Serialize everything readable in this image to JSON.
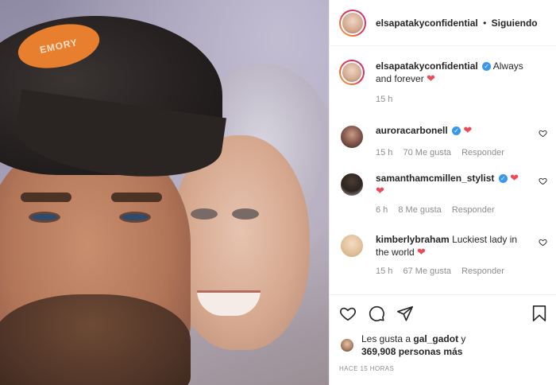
{
  "post": {
    "author": "elsapatakyconfidential",
    "separator": "•",
    "follow_state": "Siguiendo",
    "caption_text": "Always and forever",
    "caption_time": "15 h",
    "photo_patch_text": "EMORY"
  },
  "comments": [
    {
      "username": "auroracarbonell",
      "verified": true,
      "text": "",
      "time": "15 h",
      "likes": "70 Me gusta",
      "reply": "Responder"
    },
    {
      "username": "samanthamcmillen_stylist",
      "verified": true,
      "text": "",
      "time": "6 h",
      "likes": "8 Me gusta",
      "reply": "Responder"
    },
    {
      "username": "kimberlybraham",
      "verified": false,
      "text": "Luckiest lady in the world",
      "time": "15 h",
      "likes": "67 Me gusta",
      "reply": "Responder"
    }
  ],
  "likes_summary": {
    "prefix": "Les gusta a",
    "user": "gal_gadot",
    "connector": "y",
    "count": "369,908 personas más"
  },
  "timestamp": "HACE 15 HORAS",
  "colors": {
    "heart": "#ed4956",
    "verified": "#3897f0",
    "muted": "#8e8e8e"
  },
  "icons": [
    "heart-icon",
    "comment-icon",
    "share-icon",
    "bookmark-icon",
    "verified-icon"
  ]
}
